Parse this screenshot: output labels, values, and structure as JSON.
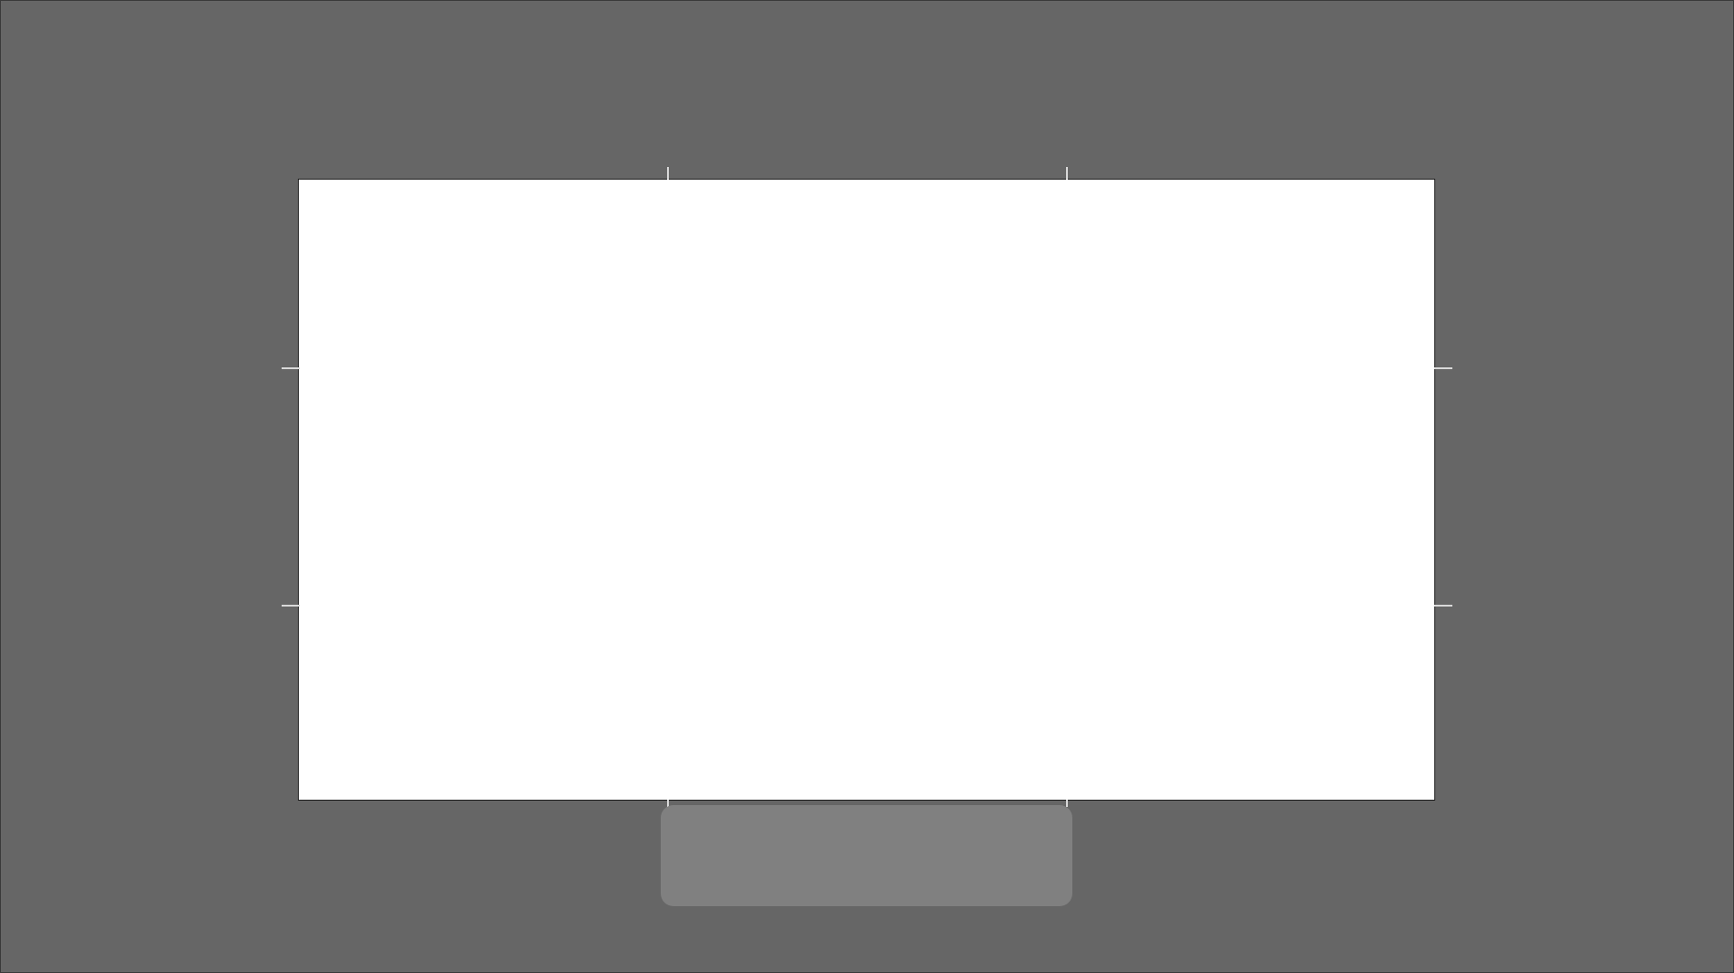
{
  "colors": {
    "background": "#666666",
    "canvas": "#ffffff",
    "canvas_border": "#1c1c1c",
    "crop_marks": "#d9d9d9",
    "toolbar_panel": "#808080"
  },
  "canvas": {
    "content": ""
  },
  "toolbar": {
    "label": ""
  }
}
